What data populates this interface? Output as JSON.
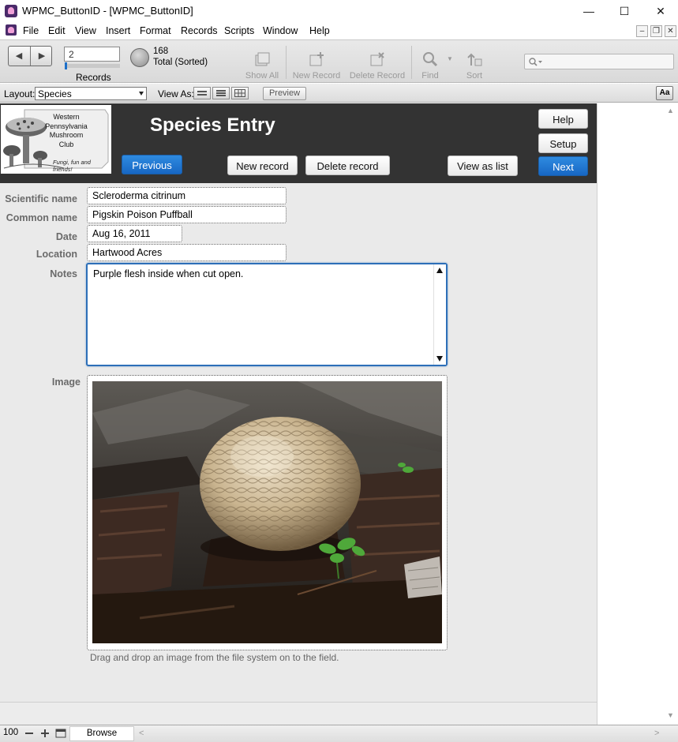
{
  "window": {
    "title": "WPMC_ButtonID - [WPMC_ButtonID]",
    "minimize_glyph": "—",
    "maximize_glyph": "☐",
    "close_glyph": "✕"
  },
  "menu": {
    "items": [
      "File",
      "Edit",
      "View",
      "Insert",
      "Format",
      "Records",
      "Scripts",
      "Window",
      "Help"
    ],
    "mdi": [
      "–",
      "❐",
      "✕"
    ]
  },
  "toolbar": {
    "current_record": "2",
    "records_label": "Records",
    "found_count": "168",
    "found_status": "Total (Sorted)",
    "record_position": 0.01,
    "tools": [
      {
        "label": "Show All",
        "icon": "show-all-icon",
        "enabled": false
      },
      {
        "label": "New Record",
        "icon": "new-record-icon",
        "enabled": false
      },
      {
        "label": "Delete Record",
        "icon": "delete-record-icon",
        "enabled": false
      },
      {
        "label": "Find",
        "icon": "find-icon",
        "enabled": false
      },
      {
        "label": "Sort",
        "icon": "sort-icon",
        "enabled": false
      }
    ],
    "search_placeholder": ""
  },
  "layoutbar": {
    "layout_label": "Layout:",
    "layout_value": "Species",
    "view_as_label": "View As:",
    "preview_label": "Preview",
    "formatting_label": "Aa"
  },
  "header": {
    "logo_text": [
      "Western",
      "Pennsylvania",
      "Mushroom",
      "Club"
    ],
    "logo_tagline": "Fungi, fun and friends!",
    "title": "Species Entry",
    "buttons": {
      "help": "Help",
      "setup": "Setup",
      "previous": "Previous",
      "new_record": "New record",
      "delete_record": "Delete record",
      "view_as_list": "View as list",
      "next": "Next"
    },
    "colors": {
      "band": "#333333",
      "accent_blue": "#1e74d0"
    }
  },
  "record": {
    "scientific_name": {
      "label": "Scientific name",
      "value": "Scleroderma citrinum"
    },
    "common_name": {
      "label": "Common name",
      "value": "Pigskin Poison Puffball"
    },
    "date": {
      "label": "Date",
      "value": "Aug 16, 2011"
    },
    "location": {
      "label": "Location",
      "value": "Hartwood Acres"
    },
    "notes": {
      "label": "Notes",
      "value": "Purple flesh inside when cut open."
    },
    "image": {
      "label": "Image",
      "hint": "Drag and drop an image from the file system on to the field."
    }
  },
  "statusbar": {
    "zoom": "100",
    "mode": "Browse"
  }
}
